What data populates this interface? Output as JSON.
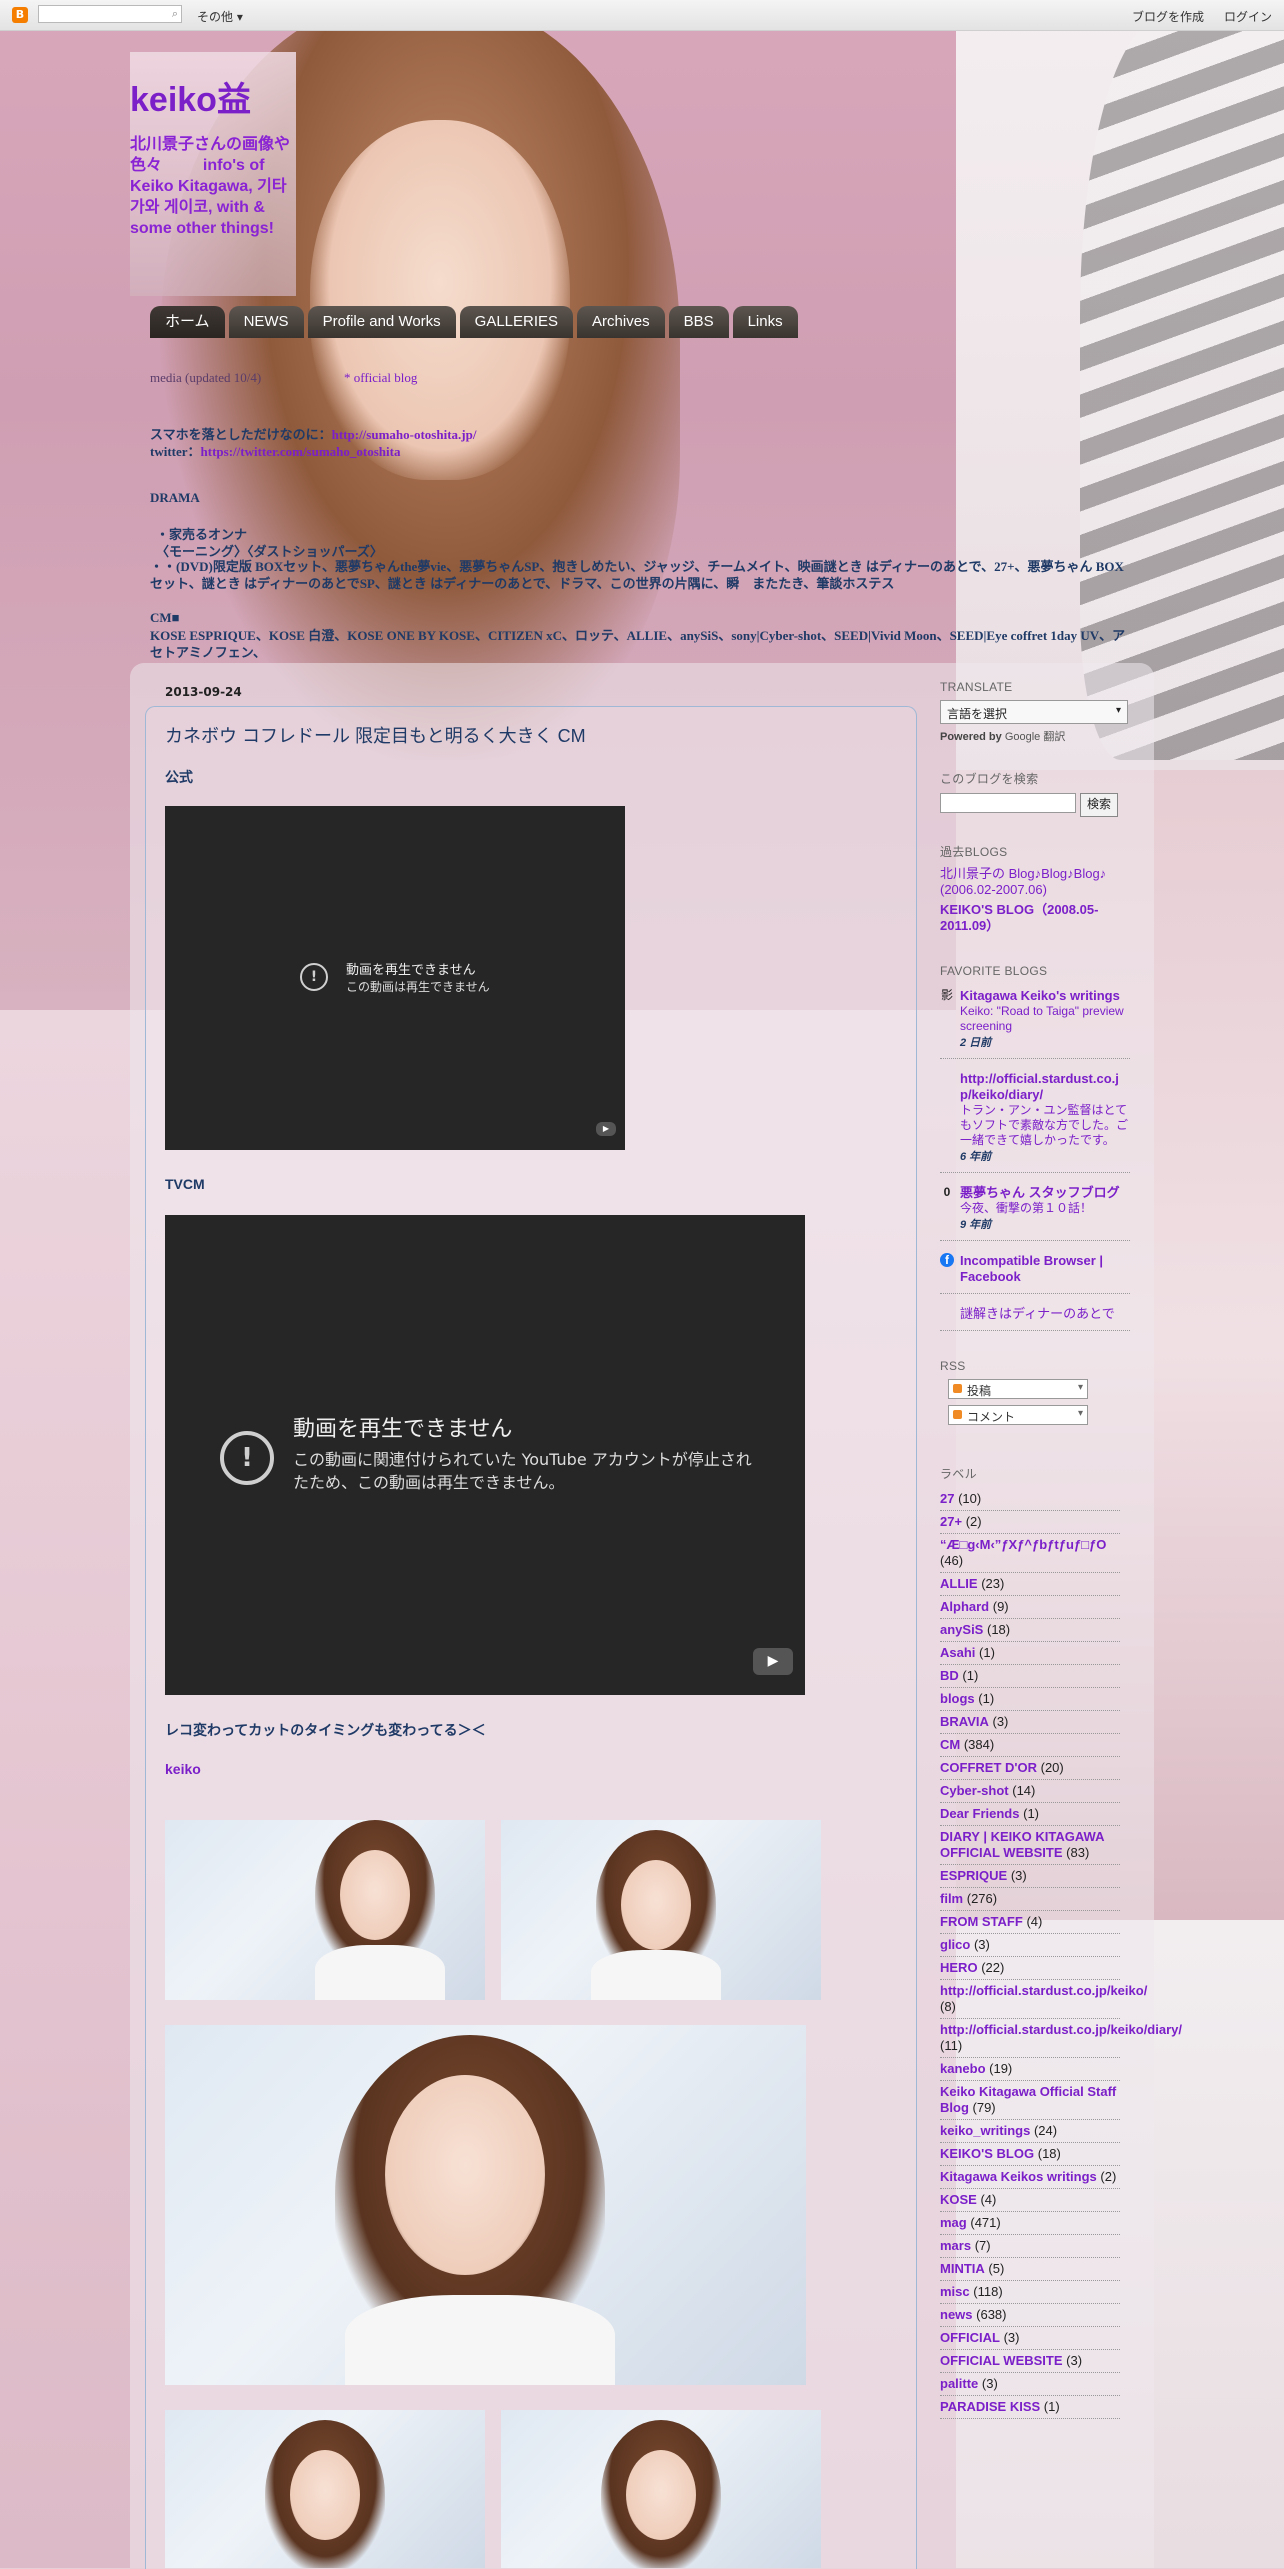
{
  "navbar": {
    "logo_letter": "B",
    "search_icon": "⌕",
    "more": "その他 ▾",
    "create_blog": "ブログを作成",
    "login": "ログイン"
  },
  "header": {
    "title": "keiko益",
    "description": "北川景子さんの画像や色々 　　 info's of Keiko Kitagawa, 기타가와 게이코, with & some other things!"
  },
  "tabs": [
    "ホーム",
    "NEWS",
    "Profile and Works",
    "GALLERIES",
    "Archives",
    "BBS",
    "Links"
  ],
  "info": {
    "line1_a": "media (updated 10/4)",
    "line1_b": "* official blog",
    "line2_label": "スマホを落としただけなのに：",
    "line2_link": "http://sumaho-otoshita.jp/",
    "line3_label": "twitter：",
    "line3_link": "https://twitter.com/sumaho_otoshita",
    "section_label": "DRAMA",
    "drama1": "・家売るオンナ",
    "drama2": "〈モーニング〉〈ダストショッパーズ〉",
    "drama3": "・・(DVD)限定版 BOXセット、悪夢ちゃんthe夢vie、悪夢ちゃんSP、抱きしめたい、ジャッジ、チームメイト、映画謎とき はディナーのあとで、27+、悪夢ちゃん BOXセット、謎とき はディナーのあとでSP、謎とき はディナーのあとで、ドラマ、この世界の片隅に、瞬　またたき、筆談ホステス",
    "cm_label": "CM■",
    "cm1": "KOSE ESPRIQUE、KOSE 白澄、KOSE ONE BY KOSE、CITIZEN xC、ロッテ、ALLIE、anySiS、sony|Cyber-shot、SEED|Vivid Moon、SEED|Eye coffret 1day UV、アセトアミノフェン、"
  },
  "post": {
    "date": "2013-09-24",
    "title": "カネボウ コフレドール 限定目もと明るく大きく CM",
    "label_official": "公式",
    "video1_title": "動画を再生できません",
    "video1_msg": "この動画は再生できません",
    "label_tvcm": "TVCM",
    "video2_title": "動画を再生できません",
    "video2_msg": "この動画に関連付けられていた YouTube アカウントが停止されたため、この動画は再生できません。",
    "caption1": "レコ変わってカットのタイミングも変わってる＞＜",
    "label_keiko": "keiko",
    "error_icon": "!",
    "play_icon": "▶"
  },
  "sidebar": {
    "translate_heading": "Translate",
    "translate_select": "言語を選択",
    "powered_by": "Powered by",
    "powered_google": "Google",
    "powered_translate": "翻訳",
    "search_heading": "このブログを検索",
    "search_button": "検索",
    "past_heading": "過去BLOGS",
    "past": [
      "北川景子の Blog♪Blog♪Blog♪ (2006.02-2007.06)",
      "KEIKO'S BLOG（2008.05-2011.09）"
    ],
    "favorite_heading": "Favorite blogs",
    "favorites": [
      {
        "icon": "影",
        "title": "Kitagawa Keiko's writings",
        "post": "Keiko: \"Road to Taiga\" preview screening",
        "time": "2 日前"
      },
      {
        "icon": "",
        "title": "http://official.stardust.co.jp/keiko/diary/",
        "post": "トラン・アン・ユン監督はとてもソフトで素敵な方でした。ご一緒できて嬉しかったです。",
        "time": "6 年前"
      },
      {
        "icon": "0",
        "title": "悪夢ちゃん スタッフブログ",
        "post": "今夜、衝撃の第１０話！",
        "time": "9 年前"
      },
      {
        "icon": "f",
        "title": "Incompatible Browser | Facebook",
        "post": "",
        "time": ""
      },
      {
        "icon": "",
        "title": "謎解きはディナーのあとで",
        "post": "",
        "time": ""
      }
    ],
    "rss_heading": "RSS",
    "rss_posts": "投稿",
    "rss_comments": "コメント",
    "labels_heading": "ラベル",
    "labels": [
      {
        "name": "27",
        "count": "(10)"
      },
      {
        "name": "27+",
        "count": "(2)"
      },
      {
        "name": "“Æ□g‹M‹”ƒXƒ^ƒbƒtƒuƒ□ƒO",
        "count": "(46)"
      },
      {
        "name": "ALLIE",
        "count": "(23)"
      },
      {
        "name": "Alphard",
        "count": "(9)"
      },
      {
        "name": "anySiS",
        "count": "(18)"
      },
      {
        "name": "Asahi",
        "count": "(1)"
      },
      {
        "name": "BD",
        "count": "(1)"
      },
      {
        "name": "blogs",
        "count": "(1)"
      },
      {
        "name": "BRAVIA",
        "count": "(3)"
      },
      {
        "name": "CM",
        "count": "(384)"
      },
      {
        "name": "COFFRET D'OR",
        "count": "(20)"
      },
      {
        "name": "Cyber-shot",
        "count": "(14)"
      },
      {
        "name": "Dear Friends",
        "count": "(1)"
      },
      {
        "name": "DIARY | KEIKO KITAGAWA OFFICIAL WEBSITE",
        "count": "(83)"
      },
      {
        "name": "ESPRIQUE",
        "count": "(3)"
      },
      {
        "name": "film",
        "count": "(276)"
      },
      {
        "name": "FROM STAFF",
        "count": "(4)"
      },
      {
        "name": "glico",
        "count": "(3)"
      },
      {
        "name": "HERO",
        "count": "(22)"
      },
      {
        "name": "http://official.stardust.co.jp/keiko/",
        "count": "(8)"
      },
      {
        "name": "http://official.stardust.co.jp/keiko/diary/",
        "count": "(11)"
      },
      {
        "name": "kanebo",
        "count": "(19)"
      },
      {
        "name": "Keiko Kitagawa Official Staff Blog",
        "count": "(79)"
      },
      {
        "name": "keiko_writings",
        "count": "(24)"
      },
      {
        "name": "KEIKO'S BLOG",
        "count": "(18)"
      },
      {
        "name": "Kitagawa Keikos writings",
        "count": "(2)"
      },
      {
        "name": "KOSE",
        "count": "(4)"
      },
      {
        "name": "mag",
        "count": "(471)"
      },
      {
        "name": "mars",
        "count": "(7)"
      },
      {
        "name": "MINTIA",
        "count": "(5)"
      },
      {
        "name": "misc",
        "count": "(118)"
      },
      {
        "name": "news",
        "count": "(638)"
      },
      {
        "name": "OFFICIAL",
        "count": "(3)"
      },
      {
        "name": "OFFICIAL WEBSITE",
        "count": "(3)"
      },
      {
        "name": "palitte",
        "count": "(3)"
      },
      {
        "name": "PARADISE KISS",
        "count": "(1)"
      }
    ]
  }
}
